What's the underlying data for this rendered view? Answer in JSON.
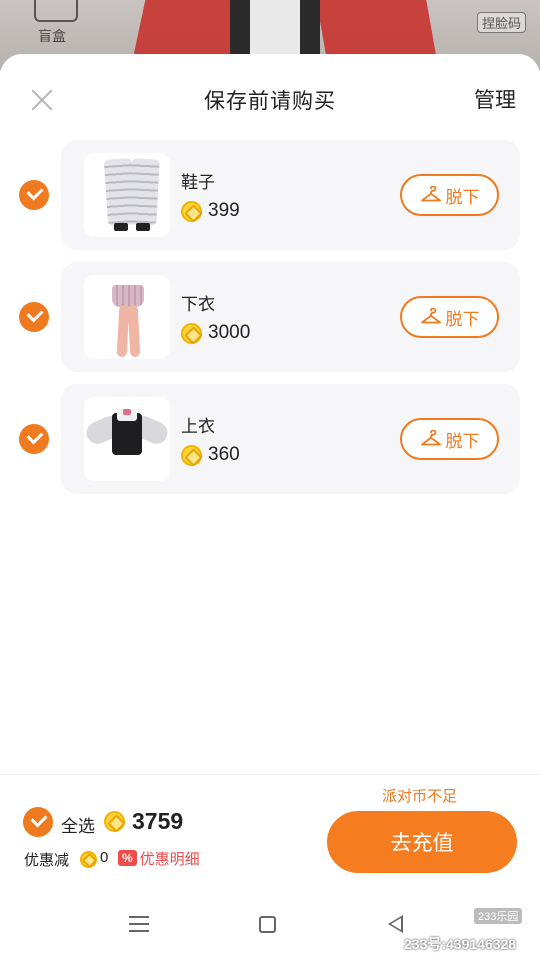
{
  "background": {
    "box_label": "盲盒",
    "right_label": "捏脸码"
  },
  "header": {
    "title": "保存前请购买",
    "manage_label": "管理"
  },
  "items": [
    {
      "name": "鞋子",
      "price": "399",
      "remove_label": "脱下",
      "checked": true
    },
    {
      "name": "下衣",
      "price": "3000",
      "remove_label": "脱下",
      "checked": true
    },
    {
      "name": "上衣",
      "price": "360",
      "remove_label": "脱下",
      "checked": true
    }
  ],
  "footer": {
    "select_all_label": "全选",
    "total": "3759",
    "discount_label": "优惠减",
    "discount_value": "0",
    "discount_badge": "%",
    "discount_detail_label": "优惠明细",
    "insufficient_notice": "派对币不足",
    "recharge_label": "去充值"
  },
  "watermark": {
    "logo": "233乐园",
    "text": "233号:439146328"
  },
  "colors": {
    "accent": "#f07a1f",
    "card_bg": "#f6f5f8",
    "discount_red": "#ee4b4b"
  }
}
